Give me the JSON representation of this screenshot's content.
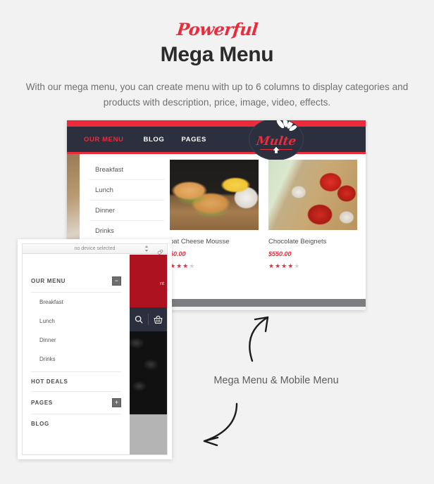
{
  "hero": {
    "script_word": "Powerful",
    "title": "Mega Menu",
    "subtitle_line1": "With our mega menu, you can create menu with up to 6 columns to display categories",
    "subtitle_line2": "and products with description, price, image, video, effects."
  },
  "colors": {
    "accent_red": "#ec2b3c",
    "nav_dark": "#2b2f3e",
    "page_bg": "#f2f2f2",
    "deep_red": "#ac1220"
  },
  "desktop": {
    "nav": [
      {
        "label": "OUR MENU",
        "active": true
      },
      {
        "label": "BLOG",
        "active": false
      },
      {
        "label": "PAGES",
        "active": false
      }
    ],
    "logo": {
      "word": "Multe"
    },
    "categories": [
      "Breakfast",
      "Lunch",
      "Dinner",
      "Drinks"
    ],
    "products": [
      {
        "name": "oat Cheese Mousse",
        "price": "50.00",
        "stars_full": 3,
        "stars_total": 4,
        "image": "burger-plate-image"
      },
      {
        "name": "Chocolate Beignets",
        "price": "$550.00",
        "stars_full": 4,
        "stars_total": 5,
        "image": "tomatoes-peppers-cutting-board-image"
      }
    ]
  },
  "mobile": {
    "device_label": "no device selected",
    "menu": [
      {
        "label": "OUR MENU",
        "toggle": "−",
        "level": "top"
      },
      {
        "label": "Breakfast",
        "level": "sub"
      },
      {
        "label": "Lunch",
        "level": "sub"
      },
      {
        "label": "Dinner",
        "level": "sub"
      },
      {
        "label": "Drinks",
        "level": "sub"
      },
      {
        "label": "HOT DEALS",
        "level": "top"
      },
      {
        "label": "PAGES",
        "toggle": "+",
        "level": "top"
      },
      {
        "label": "BLOG",
        "level": "top"
      }
    ],
    "behind_snippet": "nt"
  },
  "caption": "Mega Menu & Mobile Menu"
}
